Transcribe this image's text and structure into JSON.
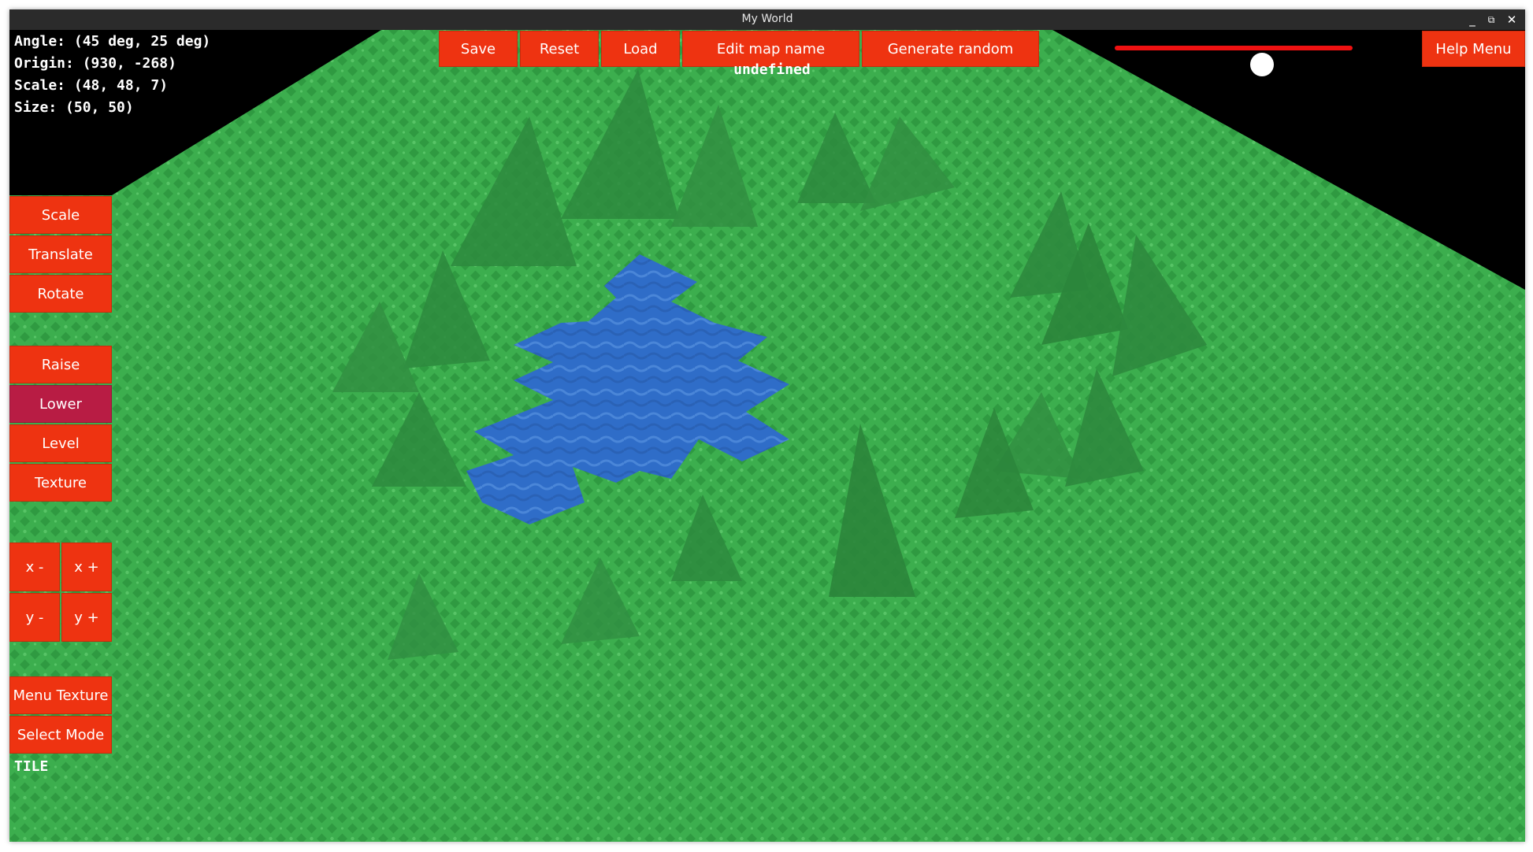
{
  "window": {
    "title": "My World",
    "controls": {
      "minimize": "_",
      "maximize": "⧉",
      "close": "✕"
    }
  },
  "info": {
    "angle": "Angle: (45 deg, 25 deg)",
    "origin": "Origin: (930, -268)",
    "scale": "Scale: (48, 48, 7)",
    "size": "Size: (50, 50)",
    "map_name": "undefined",
    "select_mode_value": "TILE"
  },
  "toolbar": {
    "save": "Save",
    "reset": "Reset",
    "load": "Load",
    "edit_map_name": "Edit map name",
    "generate_random": "Generate random",
    "help_menu": "Help Menu"
  },
  "slider": {
    "value": 0.62
  },
  "sidebar": {
    "scale": "Scale",
    "translate": "Translate",
    "rotate": "Rotate",
    "raise": "Raise",
    "lower": "Lower",
    "level": "Level",
    "texture": "Texture",
    "x_minus": "x -",
    "x_plus": "x +",
    "y_minus": "y -",
    "y_plus": "y +",
    "menu_texture": "Menu Texture",
    "select_mode": "Select Mode"
  },
  "colors": {
    "button": "#ee3311",
    "button_active": "#b81c44",
    "grass": "#3cae4e",
    "water": "#2f6dc8",
    "background": "#000000"
  }
}
